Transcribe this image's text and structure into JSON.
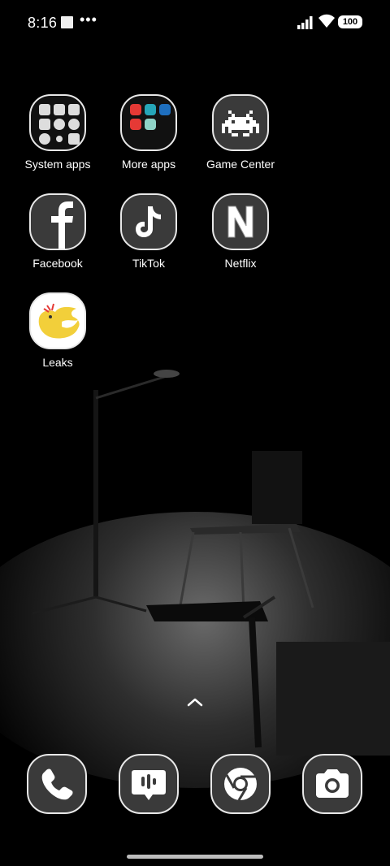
{
  "status_bar": {
    "time": "8:16",
    "more_indicator": "•••",
    "battery": "100"
  },
  "apps": [
    {
      "label": "System apps",
      "icon": "folder-icon"
    },
    {
      "label": "More apps",
      "icon": "folder-icon"
    },
    {
      "label": "Game Center",
      "icon": "space-invader-icon"
    },
    {
      "label": "Facebook",
      "icon": "facebook-icon"
    },
    {
      "label": "TikTok",
      "icon": "music-note-icon"
    },
    {
      "label": "Netflix",
      "icon": "netflix-n-icon"
    },
    {
      "label": "Leaks",
      "icon": "yellow-bird-icon"
    }
  ],
  "dock": [
    {
      "icon": "phone-icon"
    },
    {
      "icon": "message-icon"
    },
    {
      "icon": "chrome-icon"
    },
    {
      "icon": "camera-icon"
    }
  ],
  "colors": {
    "icon_background": "#3a3a3a",
    "icon_border": "#e8e8e8",
    "leaks_yellow": "#f2cf3a"
  }
}
